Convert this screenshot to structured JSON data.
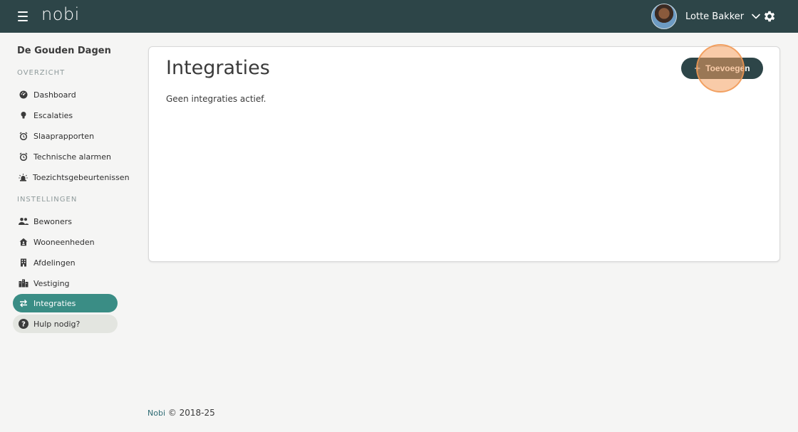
{
  "header": {
    "logo": "nobi",
    "user_name": "Lotte Bakker",
    "icons": [
      "menu-icon",
      "chevron-down-icon",
      "gear-icon"
    ]
  },
  "sidebar": {
    "org_name": "De Gouden Dagen",
    "sections": [
      {
        "label": "OVERZICHT",
        "items": [
          {
            "label": "Dashboard",
            "icon": "dashboard-icon"
          },
          {
            "label": "Escalaties",
            "icon": "lightbulb-icon"
          },
          {
            "label": "Slaaprapporten",
            "icon": "alarm-clock-icon"
          },
          {
            "label": "Technische alarmen",
            "icon": "alarm-clock-icon"
          },
          {
            "label": "Toezichtsgebeurtenissen",
            "icon": "siren-icon"
          }
        ]
      },
      {
        "label": "INSTELLINGEN",
        "items": [
          {
            "label": "Bewoners",
            "icon": "people-icon"
          },
          {
            "label": "Wooneenheden",
            "icon": "home-icon"
          },
          {
            "label": "Afdelingen",
            "icon": "building-icon"
          },
          {
            "label": "Vestiging",
            "icon": "city-icon"
          },
          {
            "label": "Integraties",
            "icon": "swap-arrows-icon",
            "active": true
          }
        ]
      }
    ],
    "help": {
      "label": "Hulp nodig?",
      "icon": "question-icon"
    }
  },
  "main": {
    "title": "Integraties",
    "add_button_label": "Toevoegen",
    "empty_text": "Geen integraties actief."
  },
  "footer": {
    "brand": "Nobi",
    "copyright": "© 2018-25"
  },
  "colors": {
    "topbar": "#2d4548",
    "accent": "#3a8d85",
    "help_bg": "#e3e5e0",
    "click_highlight": "#f4a060"
  }
}
